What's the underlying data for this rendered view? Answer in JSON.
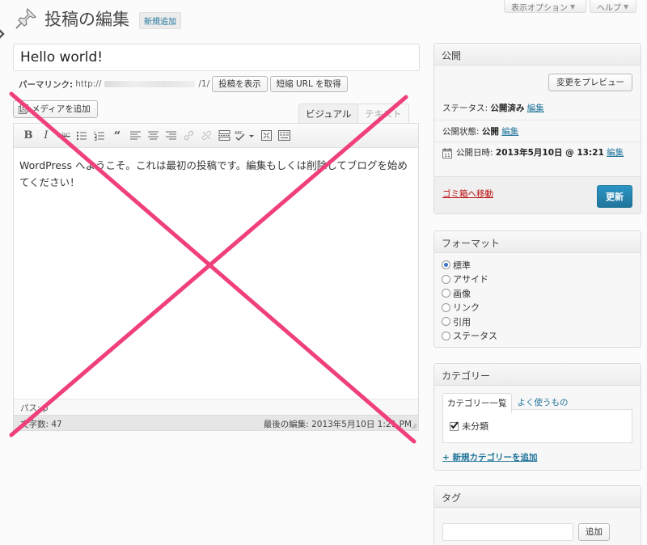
{
  "top_tabs": {
    "screen_options": "表示オプション",
    "help": "ヘルプ"
  },
  "header": {
    "title": "投稿の編集",
    "add_new": "新規追加"
  },
  "post": {
    "title": "Hello world!",
    "permalink_label": "パーマリンク:",
    "permalink_prefix": "http://",
    "permalink_suffix": "/1/",
    "view_post": "投稿を表示",
    "get_shortlink": "短縮 URL を取得"
  },
  "editor": {
    "add_media": "メディアを追加",
    "tab_visual": "ビジュアル",
    "tab_text": "テキスト",
    "content": "WordPress へようこそ。これは最初の投稿です。編集もしくは削除してブログを始めてください！",
    "path_label": "パス: p",
    "word_count": "文字数: 47",
    "last_edited": "最後の編集: 2013年5月10日 1:21 PM"
  },
  "publish_box": {
    "title": "公開",
    "preview": "変更をプレビュー",
    "status_label": "ステータス:",
    "status_value": "公開済み",
    "visibility_label": "公開状態:",
    "visibility_value": "公開",
    "date_label": "公開日時:",
    "date_value": "2013年5月10日 @ 13:21",
    "edit": "編集",
    "trash": "ゴミ箱へ移動",
    "update": "更新"
  },
  "format_box": {
    "title": "フォーマット",
    "options": [
      "標準",
      "アサイド",
      "画像",
      "リンク",
      "引用",
      "ステータス"
    ],
    "selected_index": 0
  },
  "category_box": {
    "title": "カテゴリー",
    "tab_all": "カテゴリー一覧",
    "tab_popular": "よく使うもの",
    "categories": [
      {
        "name": "未分類",
        "checked": true
      }
    ],
    "add_new": "+ 新規カテゴリーを追加"
  },
  "tag_box": {
    "title": "タグ",
    "add": "追加"
  },
  "colors": {
    "link": "#21759b",
    "overlay_x": "#f0407a",
    "trash": "#bc0b0b",
    "update_button": "#21759b"
  }
}
